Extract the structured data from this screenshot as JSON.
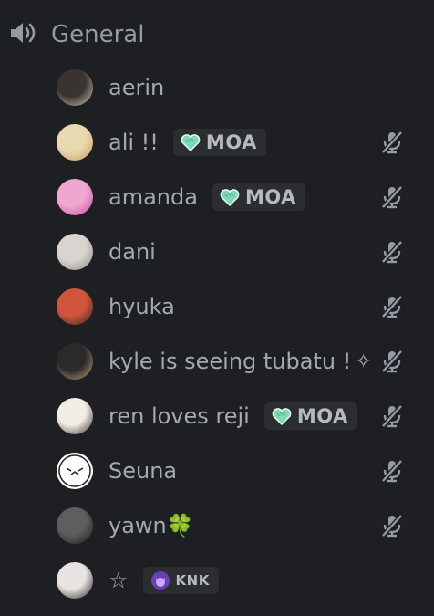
{
  "channel": {
    "name": "General",
    "icon": "speaker-icon"
  },
  "users": [
    {
      "name": "aerin",
      "extra": "",
      "tag": "",
      "tag_icon": "",
      "muted": false,
      "avatar_colors": [
        "#3a3430",
        "#d8c9b8"
      ]
    },
    {
      "name": "ali !!",
      "extra": "",
      "tag": "MOA",
      "tag_icon": "mint-heart-icon",
      "muted": true,
      "avatar_colors": [
        "#e9d9b0",
        "#c99b58"
      ]
    },
    {
      "name": "amanda",
      "extra": "",
      "tag": "MOA",
      "tag_icon": "mint-heart-icon",
      "muted": true,
      "avatar_colors": [
        "#f0a7cf",
        "#c7469e"
      ]
    },
    {
      "name": "dani",
      "extra": "",
      "tag": "",
      "tag_icon": "",
      "muted": true,
      "avatar_colors": [
        "#d8d4cf",
        "#8f8a86"
      ]
    },
    {
      "name": "hyuka",
      "extra": "",
      "tag": "",
      "tag_icon": "",
      "muted": true,
      "avatar_colors": [
        "#d1553d",
        "#3a2520"
      ]
    },
    {
      "name": "kyle is seeing tubatu !",
      "extra": "✧",
      "tag": "",
      "tag_icon": "",
      "muted": true,
      "avatar_colors": [
        "#2a2a2a",
        "#b9a27a"
      ]
    },
    {
      "name": "ren loves reji",
      "extra": "",
      "tag": "MOA",
      "tag_icon": "mint-heart-icon",
      "muted": true,
      "avatar_colors": [
        "#f2ece6",
        "#3a2b2b"
      ]
    },
    {
      "name": "Seuna",
      "extra": "",
      "tag": "",
      "tag_icon": "",
      "muted": true,
      "avatar_colors": [
        "#ffffff",
        "#222222"
      ]
    },
    {
      "name": "yawn🍀",
      "extra": "",
      "tag": "",
      "tag_icon": "",
      "muted": true,
      "avatar_colors": [
        "#5e5e5e",
        "#1d1d1d"
      ]
    },
    {
      "name": "☆",
      "extra": "",
      "tag": "KNK",
      "tag_icon": "purple-moon-icon",
      "muted": false,
      "avatar_colors": [
        "#e7e3e1",
        "#262626"
      ]
    }
  ],
  "colors": {
    "background": "#1e1f22",
    "text": "#a3a9b2",
    "tag_bg": "#2b2d31",
    "mint": "#7fd9b4",
    "purple": "#8e54d9"
  }
}
